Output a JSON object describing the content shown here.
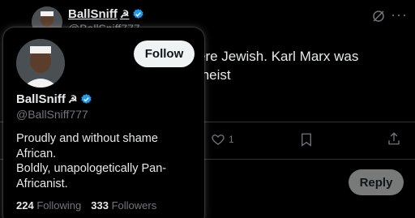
{
  "tweet": {
    "author_name": "BallSniff",
    "author_emoji": "☭",
    "author_handle": "@BallSniff777",
    "text_line1": "ere Jewish. Karl Marx was",
    "text_line2": "theist",
    "like_count": "1",
    "reply_label": "Reply"
  },
  "card": {
    "name": "BallSniff",
    "emoji": "☭",
    "handle": "@BallSniff777",
    "follow_label": "Follow",
    "bio_line1": "Proudly and without shame",
    "bio_line2": "African.",
    "bio_line3": "Boldly, unapologetically Pan-",
    "bio_line4": "Africanist.",
    "following_count": "224",
    "following_label": "Following",
    "followers_count": "333",
    "followers_label": "Followers"
  },
  "colors": {
    "verified_blue": "#1d9bf0",
    "muted_text": "#71767b",
    "reply_button_bg": "#787a7a"
  },
  "icons": [
    "verified-badge-icon",
    "grok-icon",
    "more-icon",
    "like-icon",
    "bookmark-icon",
    "share-icon"
  ]
}
